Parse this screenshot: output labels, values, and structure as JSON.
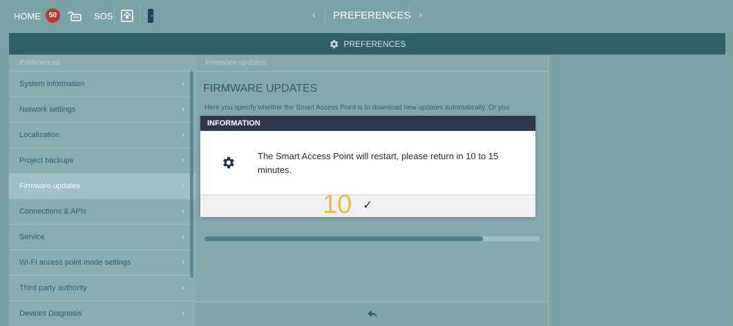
{
  "topbar": {
    "home_label": "HOME",
    "notification_count": "50",
    "sos_label": "SOS",
    "page_title": "PREFERENCES",
    "prev_arrow": "‹",
    "next_arrow": "›"
  },
  "header": {
    "title": "PREFERENCES"
  },
  "sidebar": {
    "title": "Preferences",
    "items": [
      {
        "label": "System information"
      },
      {
        "label": "Network settings"
      },
      {
        "label": "Localization"
      },
      {
        "label": "Project backups"
      },
      {
        "label": "Firmware updates"
      },
      {
        "label": "Connections & APIs"
      },
      {
        "label": "Service"
      },
      {
        "label": "Wi-Fi access point mode settings"
      },
      {
        "label": "Third party authority"
      },
      {
        "label": "Devices Diagnosis"
      }
    ],
    "active_index": 4
  },
  "main": {
    "breadcrumb": "Firmware updates",
    "heading": "FIRMWARE UPDATES",
    "description": "Here you specify whether the Smart Access Point is to download new updates automatically. Or you",
    "progress": 0.83
  },
  "dialog": {
    "title": "INFORMATION",
    "message": "The Smart Access Point will restart, please return in 10 to 15 minutes.",
    "countdown": "10",
    "confirm_label": "✓"
  },
  "colors": {
    "header": "#2f5f68",
    "dialog_header": "#2d3a4d",
    "badge": "#b53a32",
    "countdown": "#e3bf3f"
  }
}
